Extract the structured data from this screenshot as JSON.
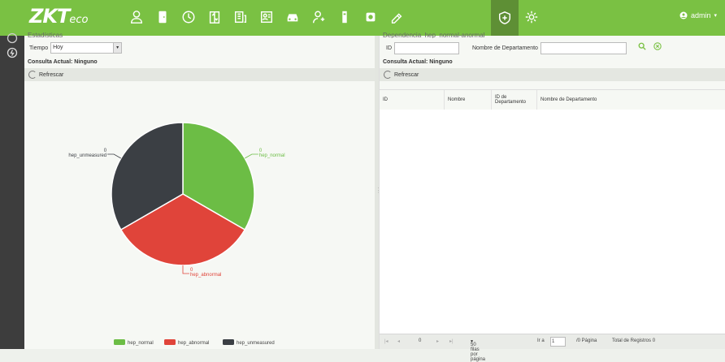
{
  "header": {
    "logo_main": "ZKT",
    "logo_sub": "eco",
    "user_label": "admin",
    "accent": "#7ac143",
    "nav_icons": [
      "person-icon",
      "door-icon",
      "clock-icon",
      "elevator-icon",
      "grid-building-icon",
      "id-card-icon",
      "car-icon",
      "visitor-icon",
      "locker-icon",
      "camera-icon",
      "patrol-icon",
      "health-shield-icon",
      "settings-icon"
    ]
  },
  "left": {
    "cut_title": "Estadísticas",
    "time_label": "Tiempo",
    "time_value": "Hoy",
    "section_title": "Consulta Actual: Ninguno",
    "refresh_label": "Refrescar"
  },
  "right": {
    "cut_title": "Dependencia_hep_normal-anormal",
    "id_label": "ID",
    "dept_label": "Nombre de Departamento",
    "section_title": "Consulta Actual: Ninguno",
    "refresh_label": "Refrescar",
    "columns": [
      "ID",
      "Nombre",
      "ID de Departamento",
      "Nombre de Departamento"
    ],
    "pager": {
      "page_value": "0",
      "rows_per_page": "50 filas por página",
      "goto_label": "Ir a",
      "goto_value": "1",
      "pages_label": "/0 Página",
      "total_label": "Total de Registros 0"
    }
  },
  "chart_data": {
    "type": "pie",
    "title": "",
    "slices": [
      {
        "name": "hep_normal",
        "value": 0,
        "label_value": "0",
        "color": "#6cbd45"
      },
      {
        "name": "hep_abnormal",
        "value": 0,
        "label_value": "0",
        "color": "#e0443a"
      },
      {
        "name": "hep_unmeasured",
        "value": 0,
        "label_value": "0",
        "color": "#3b3f44"
      }
    ],
    "legend": [
      "hep_normal",
      "hep_abnormal",
      "hep_unmeasured"
    ],
    "legend_position": "bottom"
  }
}
